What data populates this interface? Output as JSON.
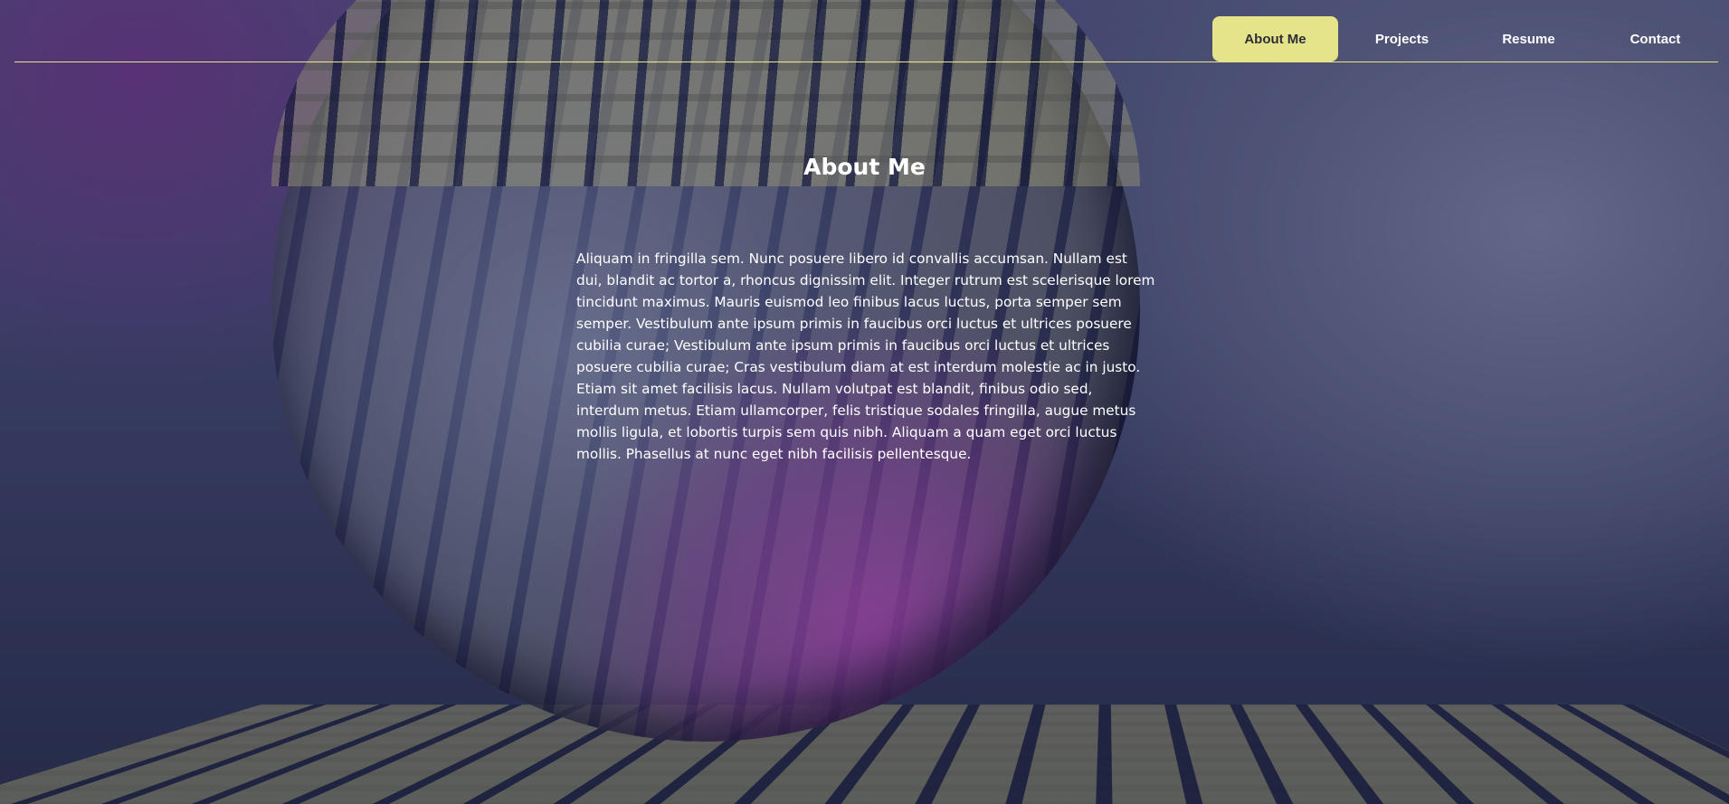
{
  "nav": {
    "items": [
      {
        "label": "About Me",
        "active": true
      },
      {
        "label": "Projects",
        "active": false
      },
      {
        "label": "Resume",
        "active": false
      },
      {
        "label": "Contact",
        "active": false
      }
    ]
  },
  "about": {
    "title": "About Me",
    "body": "Aliquam in fringilla sem. Nunc posuere libero id convallis accumsan. Nullam est dui, blandit ac tortor a, rhoncus dignissim elit. Integer rutrum est scelerisque lorem tincidunt maximus. Mauris euismod leo finibus lacus luctus, porta semper sem semper. Vestibulum ante ipsum primis in faucibus orci luctus et ultrices posuere cubilia curae; Vestibulum ante ipsum primis in faucibus orci luctus et ultrices posuere cubilia curae; Cras vestibulum diam at est interdum molestie ac in justo. Etiam sit amet facilisis lacus. Nullam volutpat est blandit, finibus odio sed, interdum metus. Etiam ullamcorper, felis tristique sodales fringilla, augue metus mollis ligula, et lobortis turpis sem quis nibh. Aliquam a quam eget orci luctus mollis. Phasellus at nunc eget nibh facilisis pellentesque."
  },
  "colors": {
    "accent": "#e6e48a",
    "text": "#ffffff",
    "active_text": "#2d2d38"
  }
}
